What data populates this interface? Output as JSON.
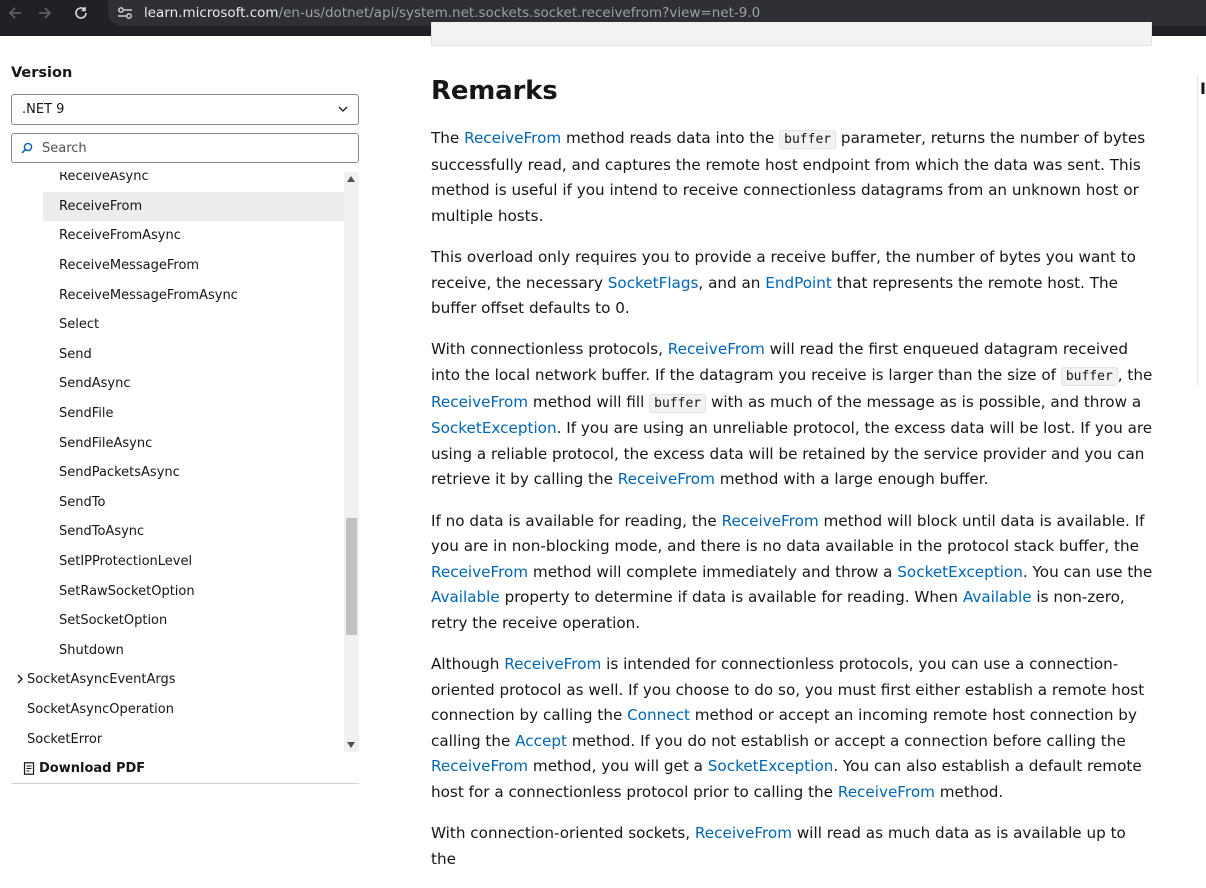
{
  "browser": {
    "url_host": "learn.microsoft.com",
    "url_path": "/en-us/dotnet/api/system.net.sockets.socket.receivefrom?view=net-9.0"
  },
  "sidebar": {
    "version_label": "Version",
    "version_value": ".NET 9",
    "search_placeholder": "Search",
    "toc_items": [
      {
        "label": "ReceiveAsync",
        "level": "child"
      },
      {
        "label": "ReceiveFrom",
        "level": "child",
        "active": true
      },
      {
        "label": "ReceiveFromAsync",
        "level": "child"
      },
      {
        "label": "ReceiveMessageFrom",
        "level": "child"
      },
      {
        "label": "ReceiveMessageFromAsync",
        "level": "child"
      },
      {
        "label": "Select",
        "level": "child"
      },
      {
        "label": "Send",
        "level": "child"
      },
      {
        "label": "SendAsync",
        "level": "child"
      },
      {
        "label": "SendFile",
        "level": "child"
      },
      {
        "label": "SendFileAsync",
        "level": "child"
      },
      {
        "label": "SendPacketsAsync",
        "level": "child"
      },
      {
        "label": "SendTo",
        "level": "child"
      },
      {
        "label": "SendToAsync",
        "level": "child"
      },
      {
        "label": "SetIPProtectionLevel",
        "level": "child"
      },
      {
        "label": "SetRawSocketOption",
        "level": "child"
      },
      {
        "label": "SetSocketOption",
        "level": "child"
      },
      {
        "label": "Shutdown",
        "level": "child"
      },
      {
        "label": "SocketAsyncEventArgs",
        "level": "parent",
        "expandable": true
      },
      {
        "label": "SocketAsyncOperation",
        "level": "parent"
      },
      {
        "label": "SocketError",
        "level": "parent"
      }
    ],
    "download_pdf": "Download PDF"
  },
  "main": {
    "heading": "Remarks",
    "paragraphs": [
      [
        {
          "t": "The "
        },
        {
          "t": "ReceiveFrom",
          "k": "link"
        },
        {
          "t": " method reads data into the "
        },
        {
          "t": "buffer",
          "k": "code"
        },
        {
          "t": " parameter, returns the number of bytes successfully read, and captures the remote host endpoint from which the data was sent. This method is useful if you intend to receive connectionless datagrams from an unknown host or multiple hosts."
        }
      ],
      [
        {
          "t": "This overload only requires you to provide a receive buffer, the number of bytes you want to receive, the necessary "
        },
        {
          "t": "SocketFlags",
          "k": "link"
        },
        {
          "t": ", and an "
        },
        {
          "t": "EndPoint",
          "k": "link"
        },
        {
          "t": " that represents the remote host. The buffer offset defaults to 0."
        }
      ],
      [
        {
          "t": "With connectionless protocols, "
        },
        {
          "t": "ReceiveFrom",
          "k": "link"
        },
        {
          "t": " will read the first enqueued datagram received into the local network buffer. If the datagram you receive is larger than the size of "
        },
        {
          "t": "buffer",
          "k": "code"
        },
        {
          "t": ", the "
        },
        {
          "t": "ReceiveFrom",
          "k": "link"
        },
        {
          "t": " method will fill "
        },
        {
          "t": "buffer",
          "k": "code"
        },
        {
          "t": " with as much of the message as is possible, and throw a "
        },
        {
          "t": "SocketException",
          "k": "link"
        },
        {
          "t": ". If you are using an unreliable protocol, the excess data will be lost. If you are using a reliable protocol, the excess data will be retained by the service provider and you can retrieve it by calling the "
        },
        {
          "t": "ReceiveFrom",
          "k": "link"
        },
        {
          "t": " method with a large enough buffer."
        }
      ],
      [
        {
          "t": "If no data is available for reading, the "
        },
        {
          "t": "ReceiveFrom",
          "k": "link"
        },
        {
          "t": " method will block until data is available. If you are in non-blocking mode, and there is no data available in the protocol stack buffer, the "
        },
        {
          "t": "ReceiveFrom",
          "k": "link"
        },
        {
          "t": " method will complete immediately and throw a "
        },
        {
          "t": "SocketException",
          "k": "link"
        },
        {
          "t": ". You can use the "
        },
        {
          "t": "Available",
          "k": "link"
        },
        {
          "t": " property to determine if data is available for reading. When "
        },
        {
          "t": "Available",
          "k": "link"
        },
        {
          "t": " is non-zero, retry the receive operation."
        }
      ],
      [
        {
          "t": "Although "
        },
        {
          "t": "ReceiveFrom",
          "k": "link"
        },
        {
          "t": " is intended for connectionless protocols, you can use a connection-oriented protocol as well. If you choose to do so, you must first either establish a remote host connection by calling the "
        },
        {
          "t": "Connect",
          "k": "link"
        },
        {
          "t": " method or accept an incoming remote host connection by calling the "
        },
        {
          "t": "Accept",
          "k": "link"
        },
        {
          "t": " method. If you do not establish or accept a connection before calling the "
        },
        {
          "t": "ReceiveFrom",
          "k": "link"
        },
        {
          "t": " method, you will get a "
        },
        {
          "t": "SocketException",
          "k": "link"
        },
        {
          "t": ". You can also establish a default remote host for a connectionless protocol prior to calling the "
        },
        {
          "t": "ReceiveFrom",
          "k": "link"
        },
        {
          "t": " method."
        }
      ],
      [
        {
          "t": "With connection-oriented sockets, "
        },
        {
          "t": "ReceiveFrom",
          "k": "link"
        },
        {
          "t": " will read as much data as is available up to the"
        }
      ]
    ],
    "right_edge_char": "I"
  },
  "colors": {
    "link": "#0065b3",
    "chrome": "#202124",
    "active_toc": "#ececec"
  }
}
